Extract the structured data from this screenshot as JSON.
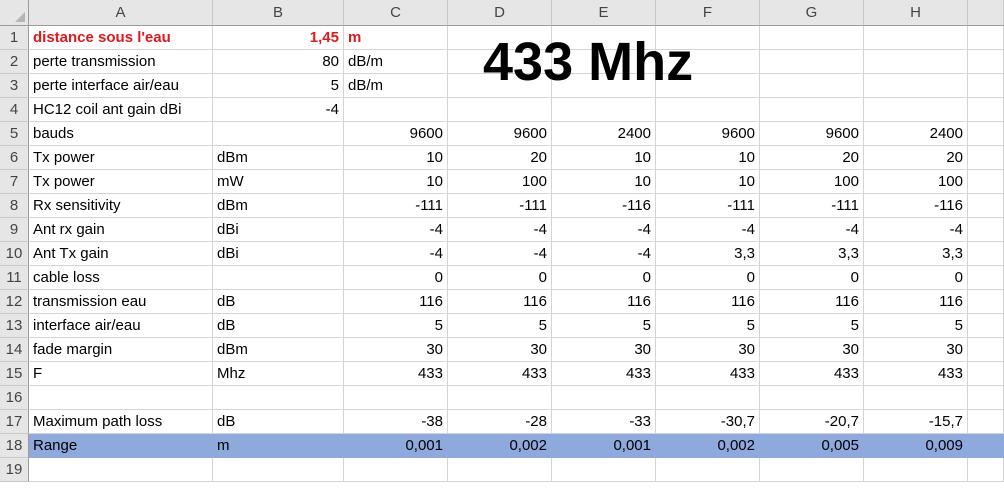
{
  "columns": [
    "A",
    "B",
    "C",
    "D",
    "E",
    "F",
    "G",
    "H"
  ],
  "row_numbers": [
    "1",
    "2",
    "3",
    "4",
    "5",
    "6",
    "7",
    "8",
    "9",
    "10",
    "11",
    "12",
    "13",
    "14",
    "15",
    "16",
    "17",
    "18",
    "19"
  ],
  "title_text": "433 Mhz",
  "rows": [
    {
      "A": "distance sous l'eau",
      "B": "1,45",
      "C": "m"
    },
    {
      "A": "perte transmission",
      "B": "80",
      "C": "dB/m"
    },
    {
      "A": "perte interface air/eau",
      "B": "5",
      "C": "dB/m"
    },
    {
      "A": "HC12 coil ant gain dBi",
      "B": "-4"
    },
    {
      "A": "bauds",
      "C": "9600",
      "D": "9600",
      "E": "2400",
      "F": "9600",
      "G": "9600",
      "H": "2400"
    },
    {
      "A": "Tx power",
      "B": "dBm",
      "C": "10",
      "D": "20",
      "E": "10",
      "F": "10",
      "G": "20",
      "H": "20"
    },
    {
      "A": "Tx power",
      "B": "mW",
      "C": "10",
      "D": "100",
      "E": "10",
      "F": "10",
      "G": "100",
      "H": "100"
    },
    {
      "A": "Rx sensitivity",
      "B": "dBm",
      "C": "-111",
      "D": "-111",
      "E": "-116",
      "F": "-111",
      "G": "-111",
      "H": "-116"
    },
    {
      "A": "Ant rx gain",
      "B": "dBi",
      "C": "-4",
      "D": "-4",
      "E": "-4",
      "F": "-4",
      "G": "-4",
      "H": "-4"
    },
    {
      "A": "Ant Tx gain",
      "B": "dBi",
      "C": "-4",
      "D": "-4",
      "E": "-4",
      "F": "3,3",
      "G": "3,3",
      "H": "3,3"
    },
    {
      "A": "cable loss",
      "C": "0",
      "D": "0",
      "E": "0",
      "F": "0",
      "G": "0",
      "H": "0"
    },
    {
      "A": "transmission eau",
      "B": "dB",
      "C": "116",
      "D": "116",
      "E": "116",
      "F": "116",
      "G": "116",
      "H": "116"
    },
    {
      "A": "interface air/eau",
      "B": "dB",
      "C": "5",
      "D": "5",
      "E": "5",
      "F": "5",
      "G": "5",
      "H": "5"
    },
    {
      "A": "fade margin",
      "B": "dBm",
      "C": "30",
      "D": "30",
      "E": "30",
      "F": "30",
      "G": "30",
      "H": "30"
    },
    {
      "A": "F",
      "B": "Mhz",
      "C": "433",
      "D": "433",
      "E": "433",
      "F": "433",
      "G": "433",
      "H": "433"
    },
    {},
    {
      "A": "Maximum path loss",
      "B": "dB",
      "C": "-38",
      "D": "-28",
      "E": "-33",
      "F": "-30,7",
      "G": "-20,7",
      "H": "-15,7"
    },
    {
      "A": "Range",
      "B": "m",
      "C": "0,001",
      "D": "0,002",
      "E": "0,001",
      "F": "0,002",
      "G": "0,005",
      "H": "0,009"
    },
    {}
  ],
  "colors": {
    "highlight_row": "#8ea9db",
    "red_text": "#e0191e",
    "header_bg": "#e6e6e6"
  }
}
